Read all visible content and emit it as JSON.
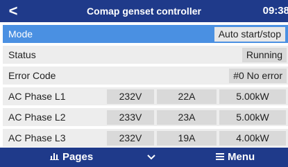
{
  "header": {
    "back_glyph": "<",
    "title": "Comap genset controller",
    "clock": "09:38"
  },
  "rows": [
    {
      "label": "Mode",
      "value": "Auto start/stop",
      "selected": true
    },
    {
      "label": "Status",
      "value": "Running"
    },
    {
      "label": "Error Code",
      "value": "#0 No error"
    },
    {
      "label": "AC Phase L1",
      "voltage": "232V",
      "current": "22A",
      "power": "5.00kW"
    },
    {
      "label": "AC Phase L2",
      "voltage": "233V",
      "current": "23A",
      "power": "5.00kW"
    },
    {
      "label": "AC Phase L3",
      "voltage": "232V",
      "current": "19A",
      "power": "4.00kW"
    }
  ],
  "footer": {
    "pages_label": "Pages",
    "pages_icon": "bar-chart-icon",
    "chevron_icon": "chevron-down-icon",
    "menu_label": "Menu",
    "menu_icon": "hamburger-menu-icon"
  },
  "colors": {
    "header_bg": "#1f3a8a",
    "selected_row": "#4a90e2",
    "row_bg": "#ededed",
    "value_box": "#d9d9d9"
  }
}
